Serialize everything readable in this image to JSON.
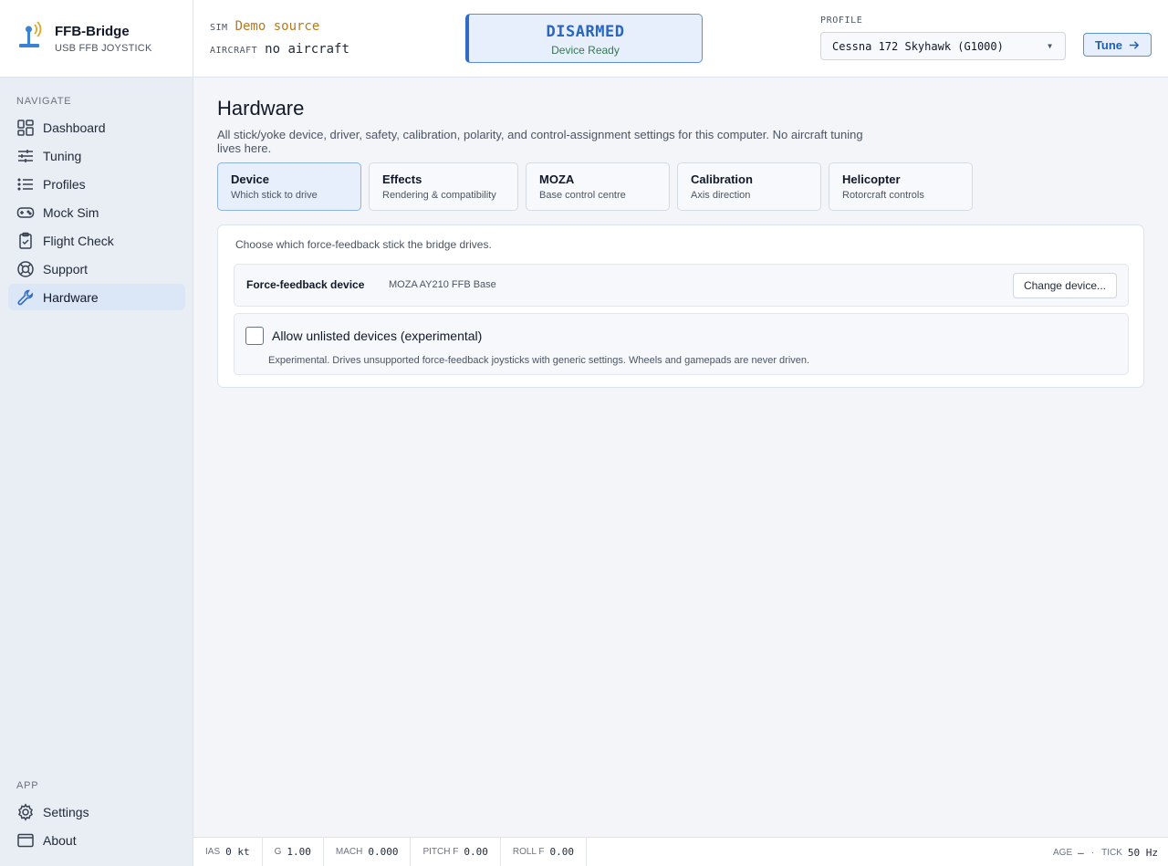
{
  "app": {
    "title": "FFB-Bridge",
    "subtitle": "USB FFB JOYSTICK"
  },
  "sidebar": {
    "nav_heading": "NAVIGATE",
    "items": [
      {
        "label": "Dashboard",
        "icon": "dashboard-icon"
      },
      {
        "label": "Tuning",
        "icon": "sliders-icon"
      },
      {
        "label": "Profiles",
        "icon": "list-icon"
      },
      {
        "label": "Mock Sim",
        "icon": "gamepad-icon"
      },
      {
        "label": "Flight Check",
        "icon": "clipboard-check-icon"
      },
      {
        "label": "Support",
        "icon": "lifebuoy-icon"
      },
      {
        "label": "Hardware",
        "icon": "wrench-icon",
        "active": true
      }
    ],
    "app_heading": "APP",
    "app_items": [
      {
        "label": "Settings",
        "icon": "gear-icon"
      },
      {
        "label": "About",
        "icon": "window-icon"
      }
    ]
  },
  "topbar": {
    "sim_key": "SIM",
    "sim_value": "Demo source",
    "aircraft_key": "AIRCRAFT",
    "aircraft_value": "no aircraft",
    "status_title": "DISARMED",
    "status_sub": "Device Ready",
    "profile_label": "PROFILE",
    "profile_value": "Cessna 172 Skyhawk (G1000)",
    "tune_label": "Tune"
  },
  "page": {
    "title": "Hardware",
    "description": "All stick/yoke device, driver, safety, calibration, polarity, and control-assignment settings for this computer. No aircraft tuning lives here.",
    "tabs": [
      {
        "label": "Device",
        "sub": "Which stick to drive",
        "active": true
      },
      {
        "label": "Effects",
        "sub": "Rendering & compatibility"
      },
      {
        "label": "MOZA",
        "sub": "Base control centre"
      },
      {
        "label": "Calibration",
        "sub": "Axis direction"
      },
      {
        "label": "Helicopter",
        "sub": "Rotorcraft controls"
      }
    ],
    "panel": {
      "intro": "Choose which force-feedback stick the bridge drives.",
      "device_label": "Force-feedback device",
      "device_name": "MOZA AY210 FFB Base",
      "change_button": "Change device...",
      "unlisted_label": "Allow unlisted devices (experimental)",
      "unlisted_checked": false,
      "unlisted_note": "Experimental. Drives unsupported force-feedback joysticks with generic settings. Wheels and gamepads are never driven."
    }
  },
  "footer": {
    "ias_key": "IAS",
    "ias_val": "0 kt",
    "g_key": "G",
    "g_val": "1.00",
    "mach_key": "MACH",
    "mach_val": "0.000",
    "pitch_key": "PITCH F",
    "pitch_val": "0.00",
    "roll_key": "ROLL F",
    "roll_val": "0.00",
    "age_key": "AGE",
    "age_val": "—",
    "sep": "·",
    "tick_key": "TICK",
    "tick_val": "50 Hz"
  },
  "colors": {
    "accent": "#2f6cc6",
    "status_ok": "#2e7d4b",
    "sim_source": "#b7791f",
    "active_nav": "#dbe7f6"
  }
}
